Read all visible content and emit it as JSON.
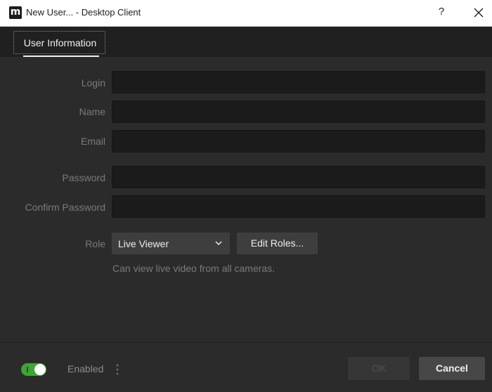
{
  "window": {
    "title": "New User... - Desktop Client",
    "logo_letter": "m",
    "help_glyph": "?",
    "close_icon": "close-icon"
  },
  "tabs": [
    {
      "label": "User Information",
      "active": true
    }
  ],
  "form": {
    "login": {
      "label": "Login",
      "value": ""
    },
    "name": {
      "label": "Name",
      "value": ""
    },
    "email": {
      "label": "Email",
      "value": ""
    },
    "password": {
      "label": "Password",
      "value": ""
    },
    "confirm_password": {
      "label": "Confirm Password",
      "value": ""
    },
    "role": {
      "label": "Role",
      "selected": "Live Viewer",
      "edit_button": "Edit Roles...",
      "description": "Can view live video from all cameras."
    }
  },
  "footer": {
    "enabled_label": "Enabled",
    "enabled": true,
    "ok_label": "OK",
    "cancel_label": "Cancel"
  },
  "colors": {
    "accent_toggle": "#3fa535",
    "background": "#2b2b2b",
    "input_background": "#1b1b1b",
    "button_background": "#3e3e3e"
  }
}
